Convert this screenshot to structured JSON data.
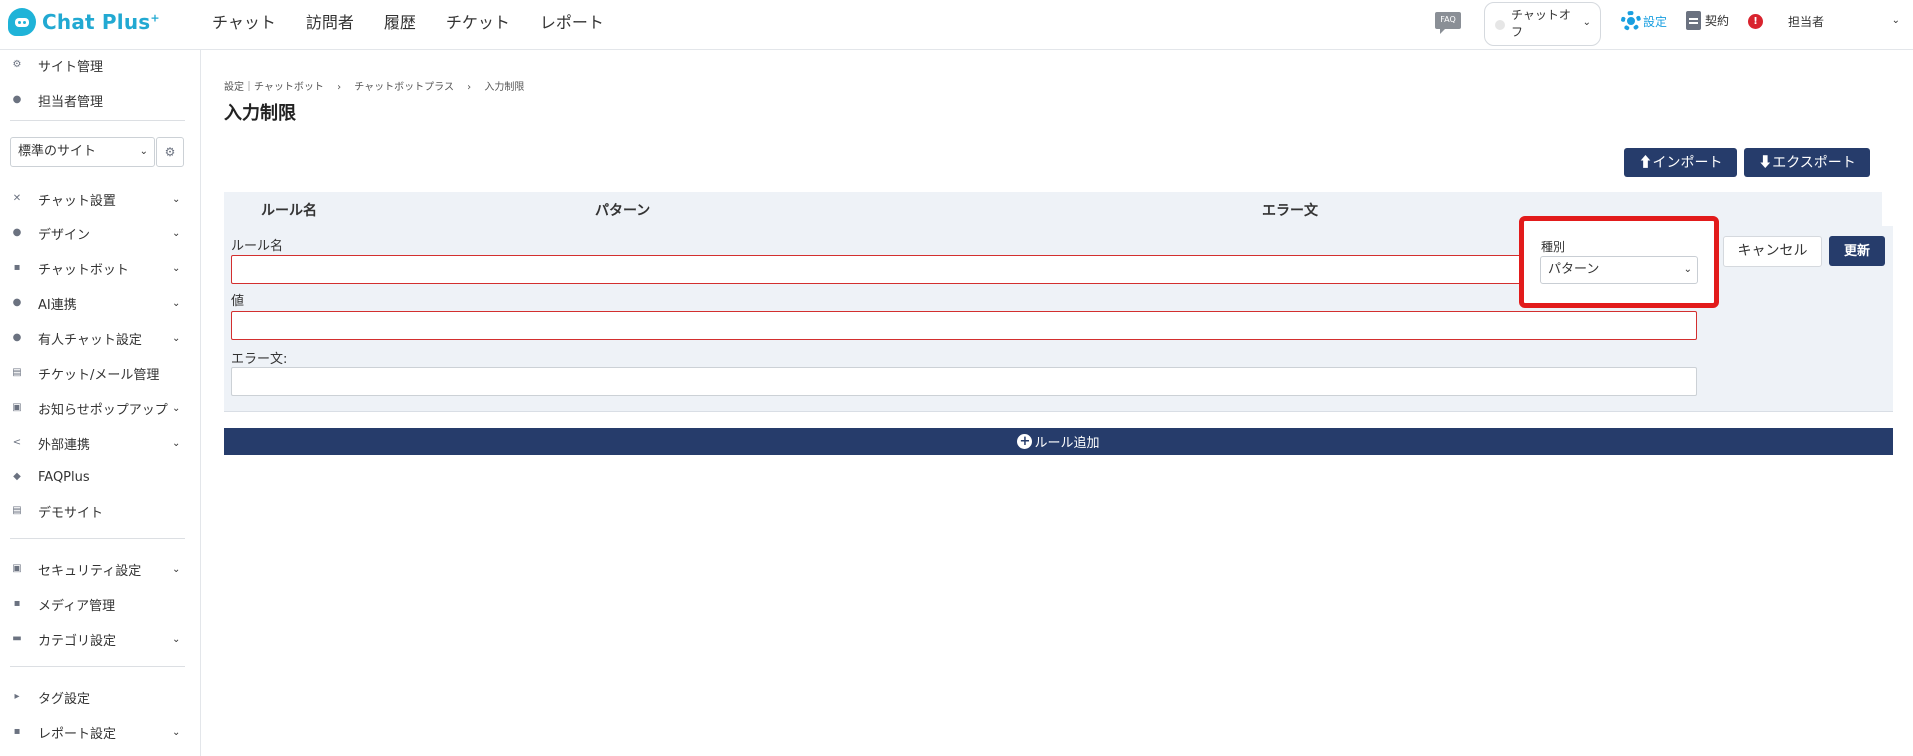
{
  "brand": {
    "name": "Chat Plus",
    "mark": "+"
  },
  "topnav": [
    "チャット",
    "訪問者",
    "履歴",
    "チケット",
    "レポート"
  ],
  "header": {
    "faq_label": "FAQ",
    "status_label": "チャットオフ",
    "settings_label": "設定",
    "contract_label": "契約",
    "alert_glyph": "!",
    "user_label": "担当者"
  },
  "sidebar": {
    "top_items": [
      {
        "label": "サイト管理",
        "icon": "gear-icon"
      },
      {
        "label": "担当者管理",
        "icon": "users-icon"
      }
    ],
    "site_select": "標準のサイト",
    "items": [
      {
        "label": "チャット設置",
        "icon": "tools-icon",
        "expandable": true
      },
      {
        "label": "デザイン",
        "icon": "palette-icon",
        "expandable": true
      },
      {
        "label": "チャットボット",
        "icon": "chat-icon",
        "expandable": true
      },
      {
        "label": "AI連携",
        "icon": "ai-icon",
        "expandable": true
      },
      {
        "label": "有人チャット設定",
        "icon": "headset-icon",
        "expandable": true
      },
      {
        "label": "チケット/メール管理",
        "icon": "ticket-icon",
        "expandable": false
      },
      {
        "label": "お知らせポップアップ",
        "icon": "popup-icon",
        "expandable": true
      },
      {
        "label": "外部連携",
        "icon": "share-icon",
        "expandable": true
      },
      {
        "label": "FAQPlus",
        "icon": "faq-shield-icon",
        "expandable": false
      },
      {
        "label": "デモサイト",
        "icon": "monitor-icon",
        "expandable": false
      }
    ],
    "items2": [
      {
        "label": "セキュリティ設定",
        "icon": "shield-icon",
        "expandable": true
      },
      {
        "label": "メディア管理",
        "icon": "image-icon",
        "expandable": false
      },
      {
        "label": "カテゴリ設定",
        "icon": "folder-icon",
        "expandable": true
      }
    ],
    "items3": [
      {
        "label": "タグ設定",
        "icon": "tag-icon",
        "expandable": false
      },
      {
        "label": "レポート設定",
        "icon": "report-icon",
        "expandable": true
      }
    ]
  },
  "breadcrumb": [
    "設定｜チャットボット",
    "›",
    "チャットボットプラス",
    "›",
    "入力制限"
  ],
  "page_title": "入力制限",
  "actions": {
    "import": "インポート",
    "export": "エクスポート"
  },
  "table": {
    "headers": [
      "ルール名",
      "パターン",
      "エラー文"
    ]
  },
  "edit_form": {
    "rule_name_label": "ルール名",
    "rule_name_value": "",
    "value_label": "値",
    "value_value": "",
    "error_label": "エラー文:",
    "error_value": "",
    "type_label": "種別",
    "type_selected": "パターン",
    "cancel": "キャンセル",
    "update": "更新"
  },
  "add_rule": "ルール追加",
  "colors": {
    "accent": "#263c6b",
    "brand": "#22a9d2",
    "highlight": "#e21b1b"
  }
}
